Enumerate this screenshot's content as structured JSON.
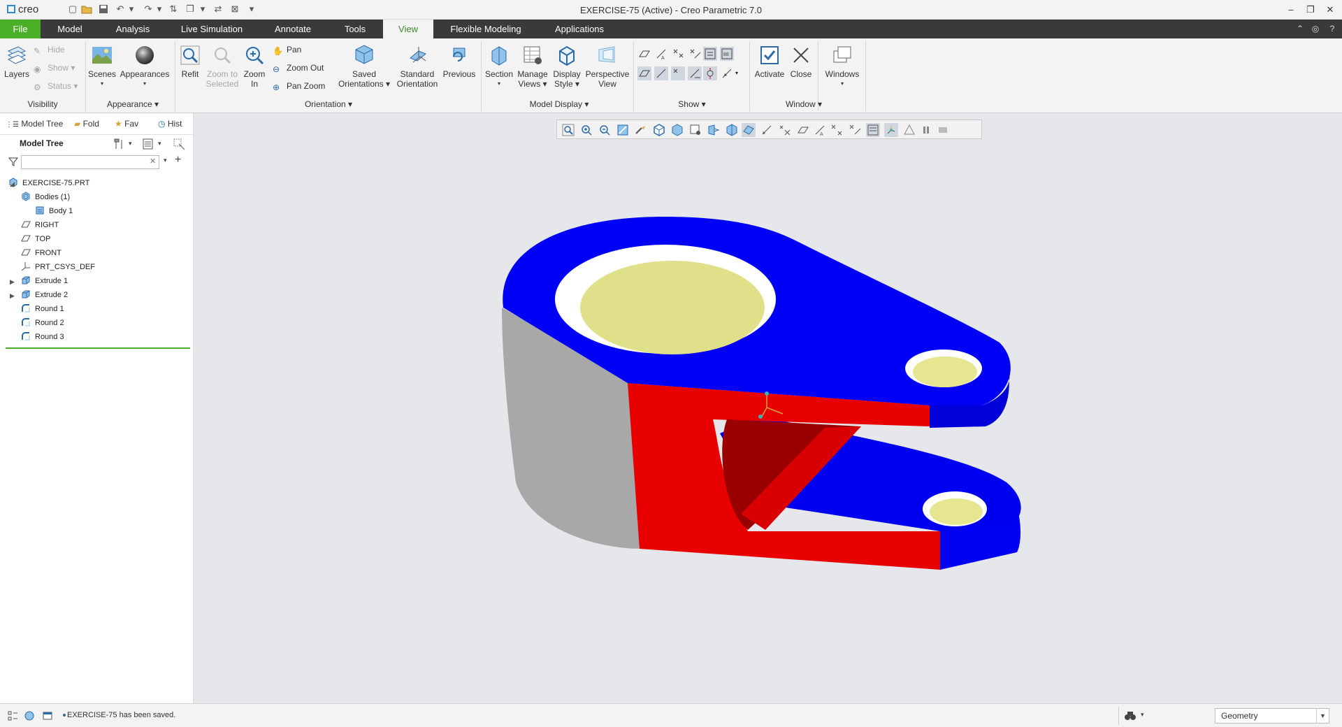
{
  "titlebar": {
    "logo": "creo",
    "title": "EXERCISE-75 (Active) - Creo Parametric 7.0"
  },
  "menu": {
    "tabs": [
      "File",
      "Model",
      "Analysis",
      "Live Simulation",
      "Annotate",
      "Tools",
      "View",
      "Flexible Modeling",
      "Applications"
    ],
    "active": "View"
  },
  "ribbon": {
    "visibility": {
      "layers": "Layers",
      "hide": "Hide",
      "show": "Show",
      "status": "Status",
      "group": "Visibility"
    },
    "appearance": {
      "scenes": "Scenes",
      "appearances": "Appearances",
      "group": "Appearance"
    },
    "orientation": {
      "refit": "Refit",
      "zoom_to_selected_1": "Zoom to",
      "zoom_to_selected_2": "Selected",
      "zoom_in_1": "Zoom",
      "zoom_in_2": "In",
      "pan": "Pan",
      "zoom_out": "Zoom Out",
      "pan_zoom": "Pan Zoom",
      "saved_1": "Saved",
      "saved_2": "Orientations",
      "standard_1": "Standard",
      "standard_2": "Orientation",
      "previous": "Previous",
      "group": "Orientation"
    },
    "model_display": {
      "section": "Section",
      "manage_1": "Manage",
      "manage_2": "Views",
      "display_1": "Display",
      "display_2": "Style",
      "perspective_1": "Perspective",
      "perspective_2": "View",
      "group": "Model Display"
    },
    "show": {
      "group": "Show"
    },
    "window": {
      "activate": "Activate",
      "close": "Close",
      "windows": "Windows",
      "group": "Window"
    }
  },
  "panel": {
    "tabs": [
      "Model Tree",
      "Fold",
      "Fav",
      "Hist"
    ],
    "header": "Model Tree",
    "search_placeholder": ""
  },
  "tree": [
    {
      "label": "EXERCISE-75.PRT",
      "icon": "part-icon"
    },
    {
      "label": "Bodies (1)",
      "icon": "bodies-icon",
      "expanded": true
    },
    {
      "label": "Body 1",
      "icon": "body-icon"
    },
    {
      "label": "RIGHT",
      "icon": "datum-plane-icon"
    },
    {
      "label": "TOP",
      "icon": "datum-plane-icon"
    },
    {
      "label": "FRONT",
      "icon": "datum-plane-icon"
    },
    {
      "label": "PRT_CSYS_DEF",
      "icon": "csys-icon"
    },
    {
      "label": "Extrude 1",
      "icon": "extrude-icon"
    },
    {
      "label": "Extrude 2",
      "icon": "extrude-icon"
    },
    {
      "label": "Round 1",
      "icon": "round-icon"
    },
    {
      "label": "Round 2",
      "icon": "round-icon"
    },
    {
      "label": "Round 3",
      "icon": "round-icon"
    }
  ],
  "status": {
    "message": "EXERCISE-75 has been saved.",
    "filter": "Geometry"
  },
  "colors": {
    "accent_green": "#4caf28",
    "menubar": "#3a3a3a",
    "model_blue": "#0000f5",
    "model_red": "#e80000",
    "model_yellow": "#e0e08a",
    "model_gray": "#a6a6a6"
  }
}
